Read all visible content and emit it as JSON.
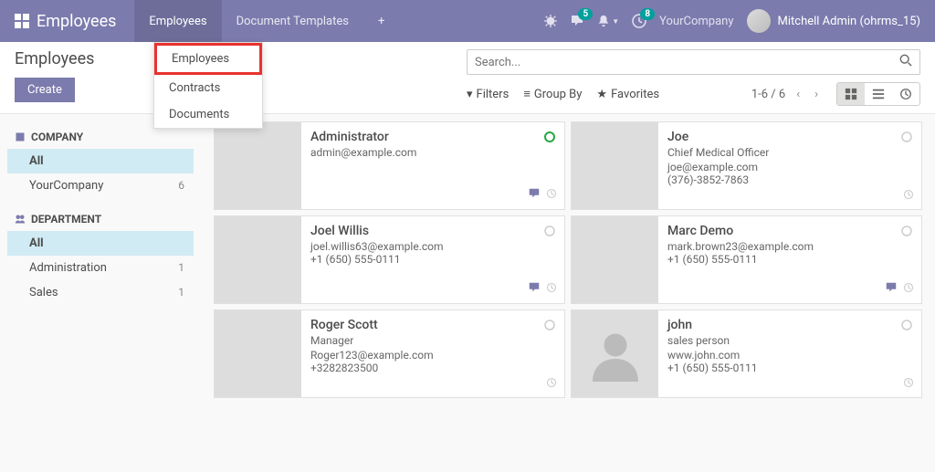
{
  "nav": {
    "brand": "Employees",
    "items": [
      "Employees",
      "Document Templates"
    ],
    "badges": {
      "messages": "5",
      "activities": "8"
    },
    "company": "YourCompany",
    "user": "Mitchell Admin (ohrms_15)"
  },
  "dropdown": [
    "Employees",
    "Contracts",
    "Documents"
  ],
  "page": {
    "title": "Employees",
    "create": "Create"
  },
  "search": {
    "placeholder": "Search..."
  },
  "toolbar": {
    "filters": "Filters",
    "groupby": "Group By",
    "favorites": "Favorites"
  },
  "pager": {
    "range": "1-6 / 6"
  },
  "sidebar": {
    "company_label": "COMPANY",
    "dept_label": "DEPARTMENT",
    "all": "All",
    "companies": [
      {
        "name": "YourCompany",
        "count": "6"
      }
    ],
    "depts": [
      {
        "name": "Administration",
        "count": "1"
      },
      {
        "name": "Sales",
        "count": "1"
      }
    ]
  },
  "cards": [
    {
      "name": "Administrator",
      "title": "",
      "email": "admin@example.com",
      "phone": "",
      "green": true,
      "msg": true
    },
    {
      "name": "Joe",
      "title": "Chief Medical Officer",
      "email": "joe@example.com",
      "phone": "(376)-3852-7863"
    },
    {
      "name": "Joel Willis",
      "title": "",
      "email": "joel.willis63@example.com",
      "phone": "+1 (650) 555-0111",
      "msg": true
    },
    {
      "name": "Marc Demo",
      "title": "",
      "email": "mark.brown23@example.com",
      "phone": "+1 (650) 555-0111",
      "msg": true
    },
    {
      "name": "Roger Scott",
      "title": "Manager",
      "email": "Roger123@example.com",
      "phone": "+3282823500"
    },
    {
      "name": "john",
      "title": "sales person",
      "email": "www.john.com",
      "phone": "+1 (650) 555-0111"
    }
  ]
}
